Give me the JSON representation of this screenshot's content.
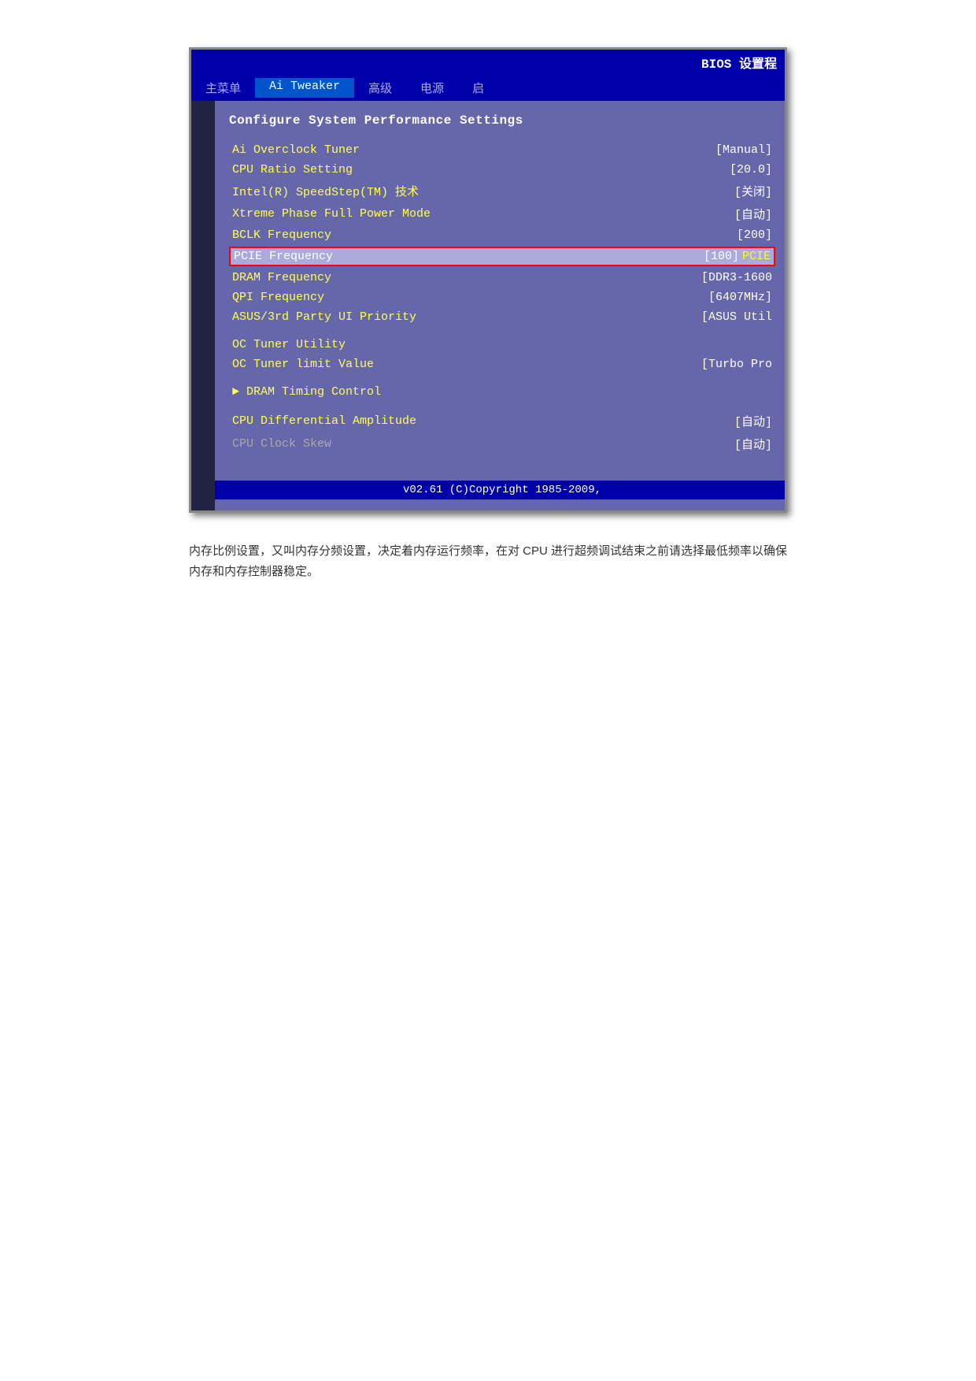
{
  "bios": {
    "top_bar": "BIOS 设置程",
    "nav": {
      "items": [
        {
          "label": "主菜单",
          "active": false
        },
        {
          "label": "Ai Tweaker",
          "active": true
        },
        {
          "label": "高级",
          "active": false
        },
        {
          "label": "电源",
          "active": false
        },
        {
          "label": "启",
          "active": false
        }
      ]
    },
    "section_title": "Configure System Performance Settings",
    "menu_items": [
      {
        "label": "Ai Overclock Tuner",
        "value": "[Manual]",
        "highlighted": false
      },
      {
        "label": "CPU Ratio Setting",
        "value": "[20.0]",
        "highlighted": false
      },
      {
        "label": "Intel(R) SpeedStep(TM) 技术",
        "value": "[关闭]",
        "highlighted": false
      },
      {
        "label": "Xtreme Phase Full Power Mode",
        "value": "[自动]",
        "highlighted": false
      },
      {
        "label": "BCLK Frequency",
        "value": "[200]",
        "highlighted": false
      },
      {
        "label": "PCIE Frequency",
        "value": "[100]",
        "highlighted": true,
        "overflow": "PCIE"
      },
      {
        "label": "DRAM Frequency",
        "value": "[DDR3-1600",
        "highlighted": false
      },
      {
        "label": "QPI Frequency",
        "value": "[6407MHz]",
        "highlighted": false
      },
      {
        "label": "ASUS/3rd Party UI Priority",
        "value": "[ASUS Util",
        "highlighted": false
      }
    ],
    "spacer_items": [
      {
        "label": "OC Tuner Utility",
        "value": ""
      },
      {
        "label": "OC Tuner limit Value",
        "value": "[Turbo Pro"
      }
    ],
    "submenu_item": "► DRAM Timing Control",
    "bottom_items": [
      {
        "label": "CPU Differential Amplitude",
        "value": "[自动]",
        "dimmed": false
      },
      {
        "label": "CPU Clock Skew",
        "value": "[自动]",
        "dimmed": true
      }
    ],
    "footer": "v02.61  (C)Copyright 1985-2009,"
  },
  "description": "内存比例设置，又叫内存分频设置，决定着内存运行频率，在对 CPU 进行超频调试结束之前请选择最低频率以确保内存和内存控制器稳定。"
}
